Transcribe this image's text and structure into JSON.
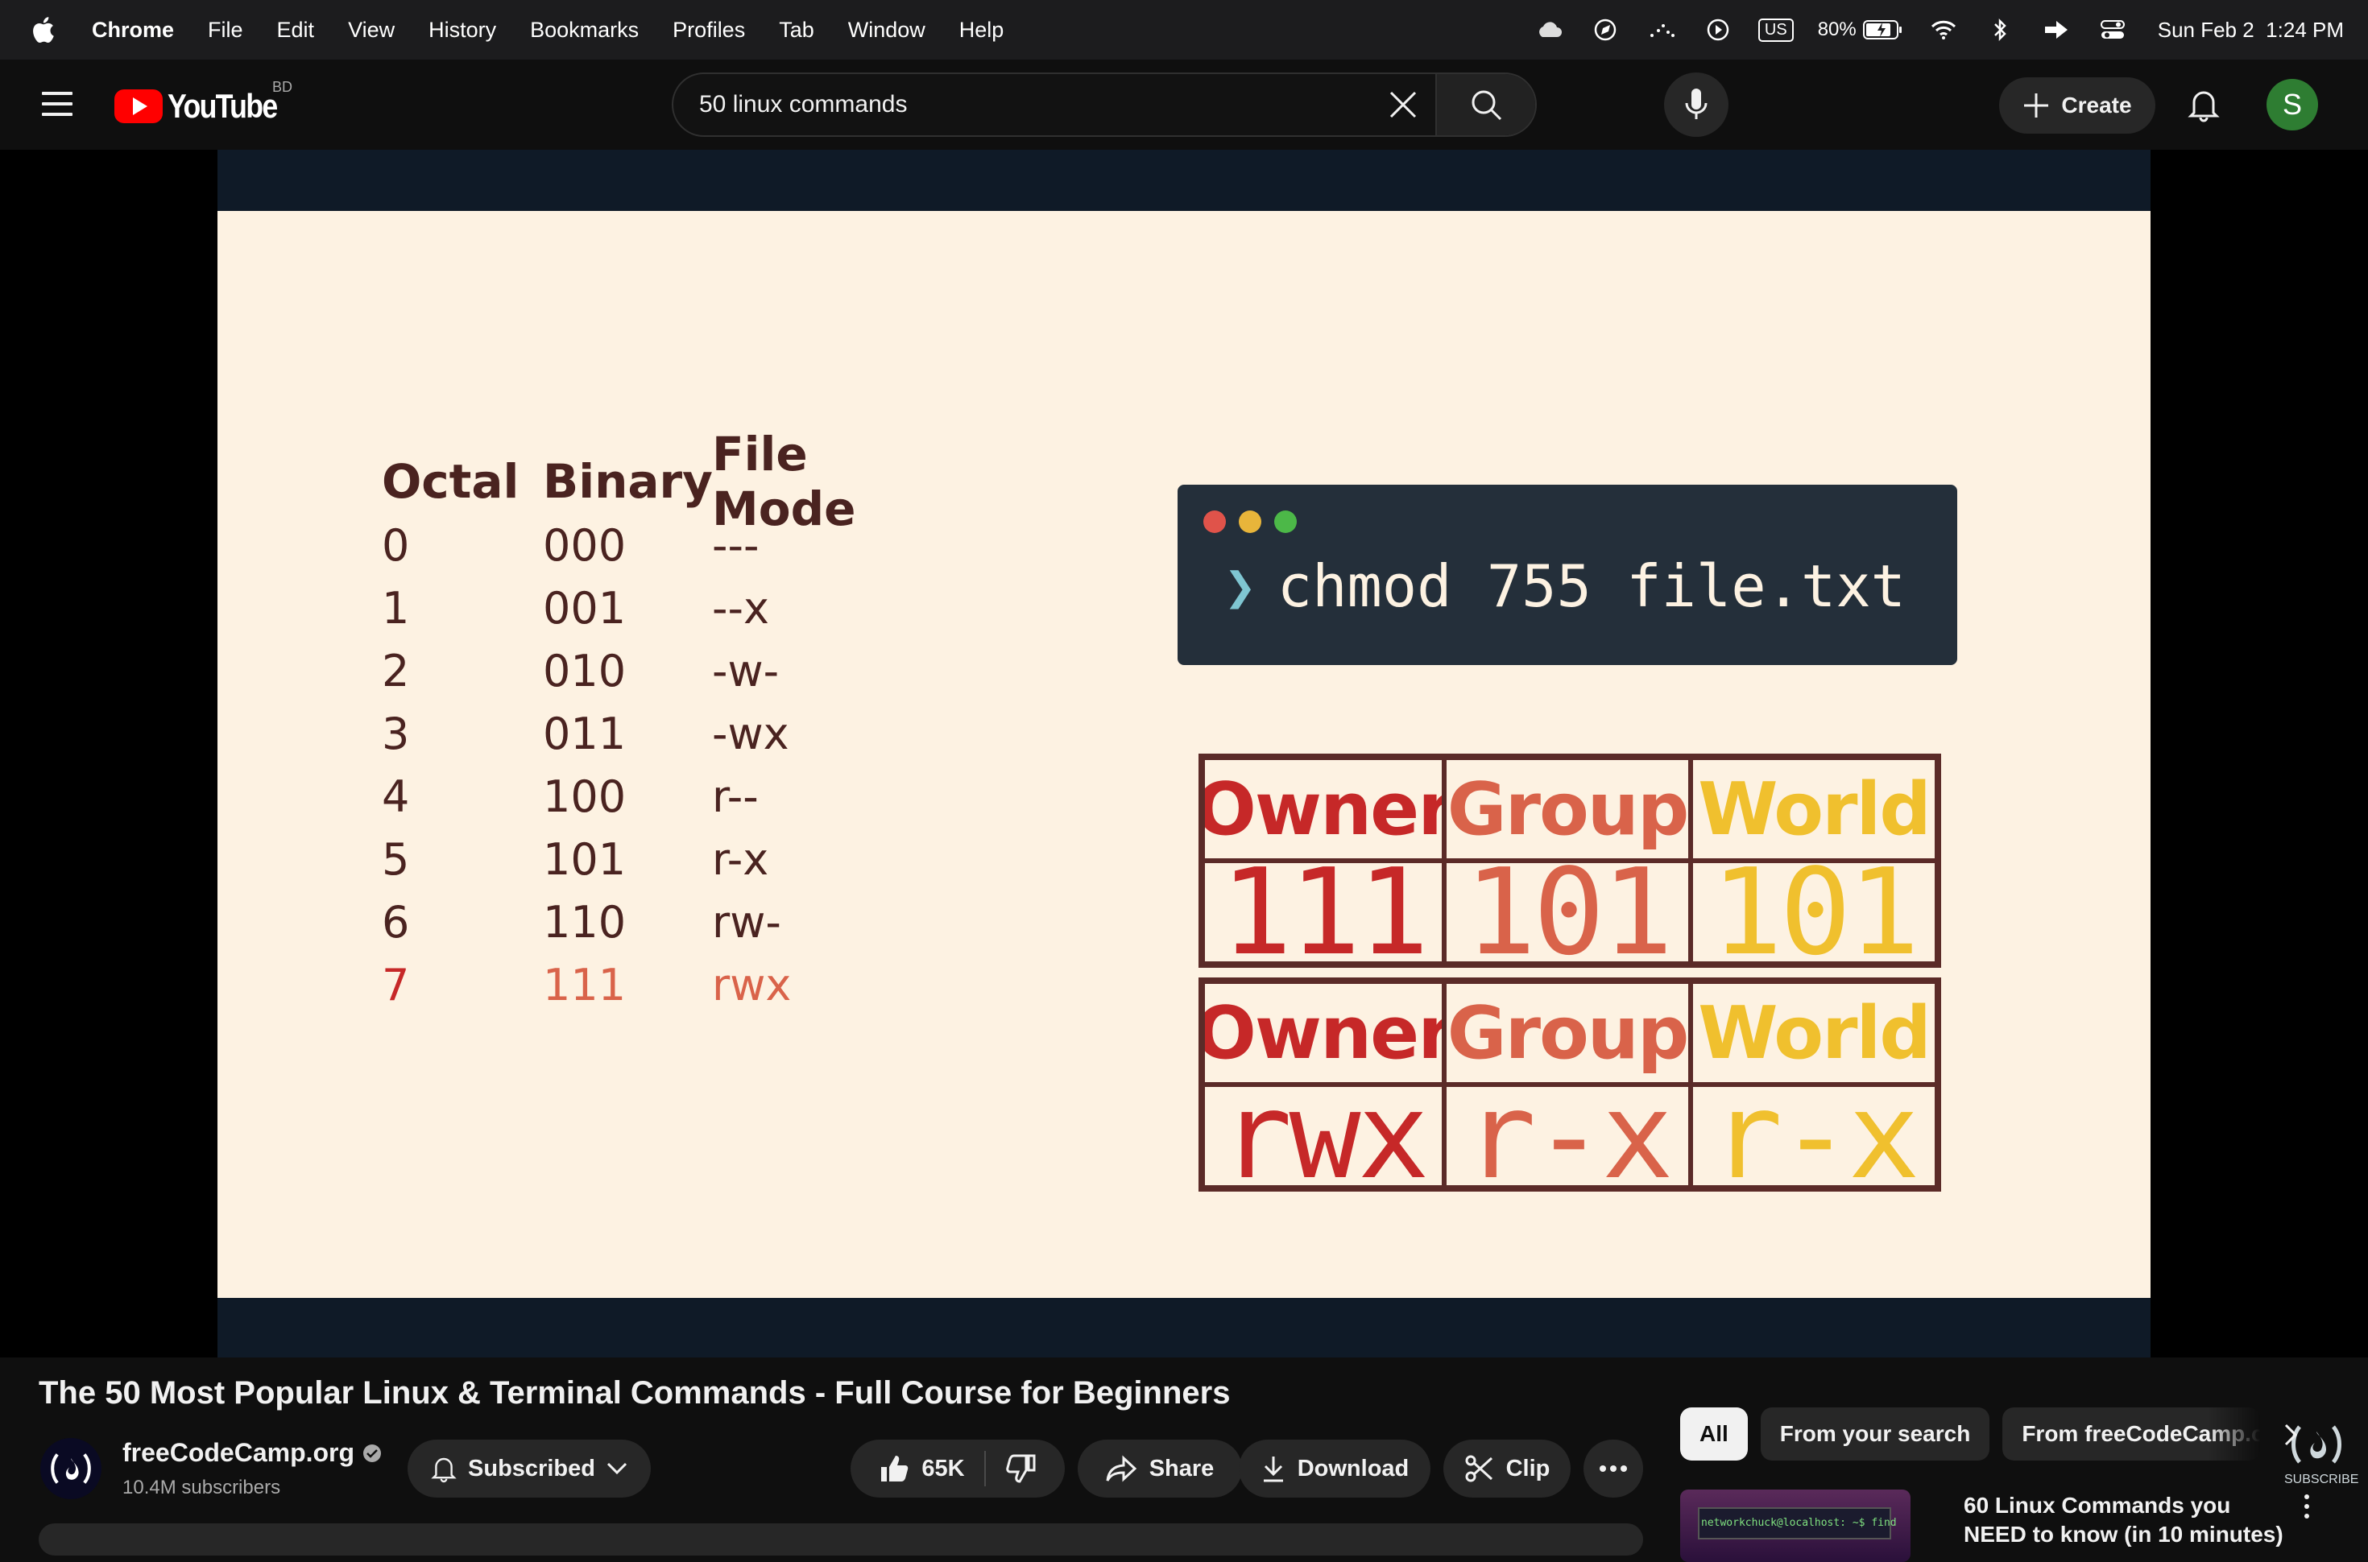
{
  "menubar": {
    "app": "Chrome",
    "items": [
      "File",
      "Edit",
      "View",
      "History",
      "Bookmarks",
      "Profiles",
      "Tab",
      "Window",
      "Help"
    ],
    "input_source": "US",
    "battery": "80%",
    "date": "Sun Feb 2",
    "time": "1:24 PM"
  },
  "youtube": {
    "logo_text": "YouTube",
    "country_code": "BD",
    "search_value": "50 linux commands",
    "create_label": "Create",
    "avatar_letter": "S",
    "brand_color": "#ff0000"
  },
  "slide": {
    "headers": [
      "Octal",
      "Binary",
      "File Mode"
    ],
    "rows": [
      {
        "octal": "0",
        "binary": "000",
        "mode": "---"
      },
      {
        "octal": "1",
        "binary": "001",
        "mode": "--x"
      },
      {
        "octal": "2",
        "binary": "010",
        "mode": "-w-"
      },
      {
        "octal": "3",
        "binary": "011",
        "mode": "-wx"
      },
      {
        "octal": "4",
        "binary": "100",
        "mode": "r--"
      },
      {
        "octal": "5",
        "binary": "101",
        "mode": "r-x"
      },
      {
        "octal": "6",
        "binary": "110",
        "mode": "rw-"
      },
      {
        "octal": "7",
        "binary": "111",
        "mode": "rwx"
      }
    ],
    "terminal_prompt": "❯",
    "terminal_command": "chmod 755 file.txt",
    "grid_labels": [
      "Owner",
      "Group",
      "World"
    ],
    "binary_values": [
      "111",
      "101",
      "101"
    ],
    "mode_values": [
      "rwx",
      "r-x",
      "r-x"
    ],
    "colors": {
      "owner": "#c62828",
      "group": "#d9634a",
      "world": "#f0c02e"
    }
  },
  "watermark": {
    "label": "SUBSCRIBE"
  },
  "video": {
    "title": "The 50 Most Popular Linux & Terminal Commands - Full Course for Beginners",
    "channel": "freeCodeCamp.org",
    "subscribers": "10.4M subscribers",
    "subscribed_label": "Subscribed",
    "likes": "65K",
    "share_label": "Share",
    "download_label": "Download",
    "clip_label": "Clip"
  },
  "sidebar": {
    "chips": [
      "All",
      "From your search",
      "From freeCodeCamp.org"
    ],
    "recommendation_title": "60 Linux Commands you NEED to know (in 10 minutes)",
    "thumb_text": "networkchuck@localhost: ~$ find"
  }
}
